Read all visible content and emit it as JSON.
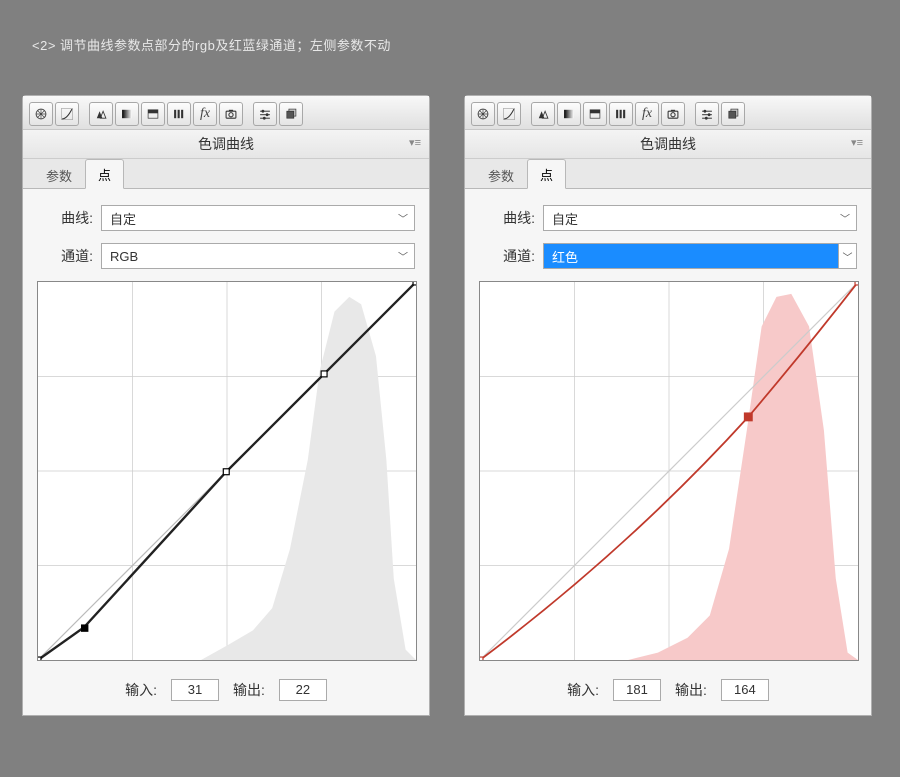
{
  "caption": "<2>  调节曲线参数点部分的rgb及红蓝绿通道；左侧参数不动",
  "panel_title": "色调曲线",
  "tabs": {
    "params": "参数",
    "points": "点"
  },
  "labels": {
    "curve": "曲线:",
    "channel": "通道:",
    "input": "输入:",
    "output": "输出:"
  },
  "left": {
    "curve_value": "自定",
    "channel_value": "RGB",
    "input": "31",
    "output": "22"
  },
  "right": {
    "curve_value": "自定",
    "channel_value": "红色",
    "input": "181",
    "output": "164"
  },
  "chart_data": [
    {
      "type": "line",
      "title": "RGB Tone Curve",
      "xlabel": "Input",
      "ylabel": "Output",
      "xlim": [
        0,
        255
      ],
      "ylim": [
        0,
        255
      ],
      "series": [
        {
          "name": "curve",
          "x": [
            0,
            31,
            127,
            193,
            255
          ],
          "y": [
            0,
            22,
            127,
            193,
            255
          ]
        }
      ],
      "selected_point": {
        "x": 31,
        "y": 22
      }
    },
    {
      "type": "line",
      "title": "Red Channel Tone Curve",
      "xlabel": "Input",
      "ylabel": "Output",
      "xlim": [
        0,
        255
      ],
      "ylim": [
        0,
        255
      ],
      "series": [
        {
          "name": "curve",
          "x": [
            0,
            60,
            120,
            181,
            255
          ],
          "y": [
            0,
            48,
            104,
            164,
            255
          ]
        }
      ],
      "selected_point": {
        "x": 181,
        "y": 164
      }
    }
  ]
}
